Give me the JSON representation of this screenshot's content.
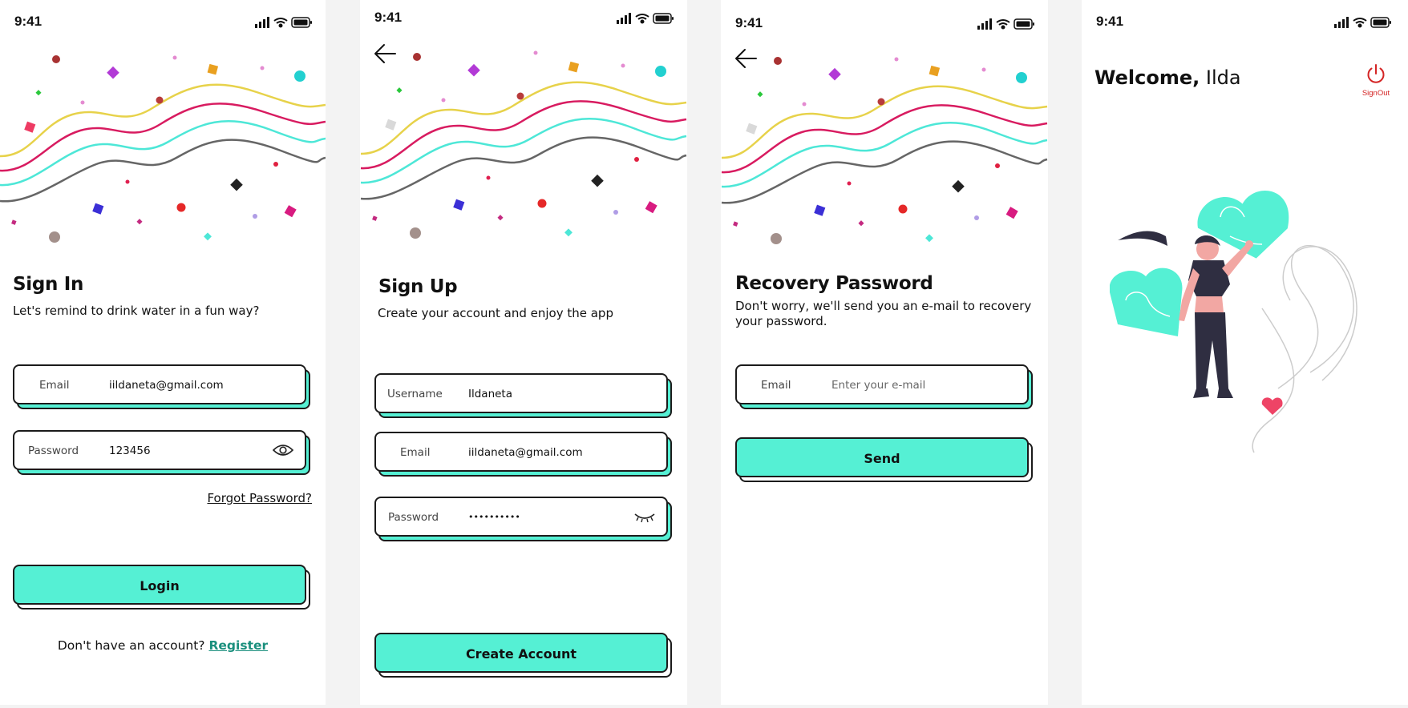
{
  "colors": {
    "accent": "#55f0d4",
    "border": "#1b1b1b",
    "link": "#1a8f7d",
    "signout": "#d42525",
    "wave_yellow": "#e7d24a",
    "wave_pink": "#d81b60",
    "wave_teal": "#4de7d7",
    "wave_gray": "#666666"
  },
  "status_bar": {
    "time": "9:41"
  },
  "sign_in": {
    "title": "Sign In",
    "subtitle": "Let's remind to drink water in a fun way?",
    "email_label": "Email",
    "email_value": "iildaneta@gmail.com",
    "password_label": "Password",
    "password_value": "123456",
    "password_icon": "eye-icon",
    "forgot_password": "Forgot Password?",
    "login_button": "Login",
    "no_account_text": "Don't have an account?",
    "register_link": "Register"
  },
  "sign_up": {
    "back_icon": "arrow-left-icon",
    "title": "Sign Up",
    "subtitle": "Create your account and enjoy the app",
    "username_label": "Username",
    "username_value": "Ildaneta",
    "email_label": "Email",
    "email_value": "iildaneta@gmail.com",
    "password_label": "Password",
    "password_value": "••••••••••",
    "password_icon": "eye-closed-icon",
    "create_button": "Create Account"
  },
  "recovery": {
    "back_icon": "arrow-left-icon",
    "title": "Recovery Password",
    "subtitle_line1": "Don't worry, we'll send you an e-mail to recovery",
    "subtitle_line2": "your password.",
    "email_label": "Email",
    "email_placeholder": "Enter your e-mail",
    "send_button": "Send"
  },
  "home": {
    "welcome": "Welcome,",
    "user_name": "Ilda",
    "signout_icon": "power-icon",
    "signout_label": "SignOut",
    "illustration": "woman-holding-hearts-illustration"
  }
}
